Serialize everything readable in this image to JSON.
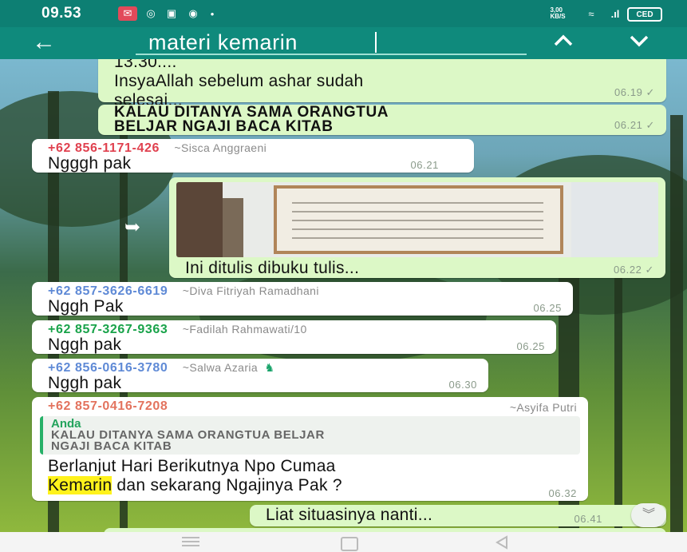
{
  "status_bar": {
    "time": "09.53",
    "network_speed": "3,00\nKB/S",
    "battery_label": "CED"
  },
  "search": {
    "query": "materi kemarin",
    "back_label": "←",
    "up_label": "⌃",
    "down_label": "⌄"
  },
  "messages": [
    {
      "type": "out",
      "lines": [
        "13.30....",
        "InsyaAllah sebelum ashar sudah",
        "selesai..."
      ],
      "time": "06.19"
    },
    {
      "type": "out",
      "lines": [
        "KALAU DITANYA SAMA ORANGTUA",
        "BELJAR NGAJI BACA KITAB"
      ],
      "time": "06.21"
    },
    {
      "type": "in",
      "sender": "+62 856-1171-426",
      "alias": "~Sisca Anggraeni",
      "text": "Ngggh pak",
      "time": "06.21"
    },
    {
      "type": "out",
      "caption": "Ini ditulis dibuku tulis...",
      "time": "06.22"
    },
    {
      "type": "in",
      "sender": "+62 857-3626-6619",
      "alias": "~Diva Fitriyah Ramadhani",
      "text": "Nggh Pak",
      "time": "06.25"
    },
    {
      "type": "in",
      "sender": "+62 857-3267-9363",
      "alias": "~Fadilah Rahmawati/10",
      "text": "Nggh pak",
      "time": "06.25"
    },
    {
      "type": "in",
      "sender": "+62 856-0616-3780",
      "alias": "~Salwa Azaria",
      "text": "Nggh pak",
      "time": "06.30"
    },
    {
      "type": "in",
      "sender": "+62 857-0416-7208",
      "alias": "~Asyifa Putri",
      "quote_author": "Anda",
      "quote_lines": [
        "KALAU DITANYA SAMA ORANGTUA BELJAR",
        "NGAJI BACA KITAB"
      ],
      "text_line1": "Berlanjut Hari Berikutnya Npo Cumaa",
      "text_highlight": "Kemarin",
      "text_line2_rest": " dan sekarang Ngajinya Pak  ?",
      "time": "06.32"
    },
    {
      "type": "out",
      "text": "Liat situasinya nanti...",
      "time": "06.41"
    }
  ],
  "colors": {
    "header": "#0f8a7c",
    "out_bubble": "#dcf8c6",
    "in_bubble": "#ffffff",
    "sender_red": "#e0414f",
    "sender_blue": "#5f8ad6",
    "sender_green": "#19a34a",
    "sender_salmon": "#e3735e",
    "highlight": "#fff21b"
  }
}
